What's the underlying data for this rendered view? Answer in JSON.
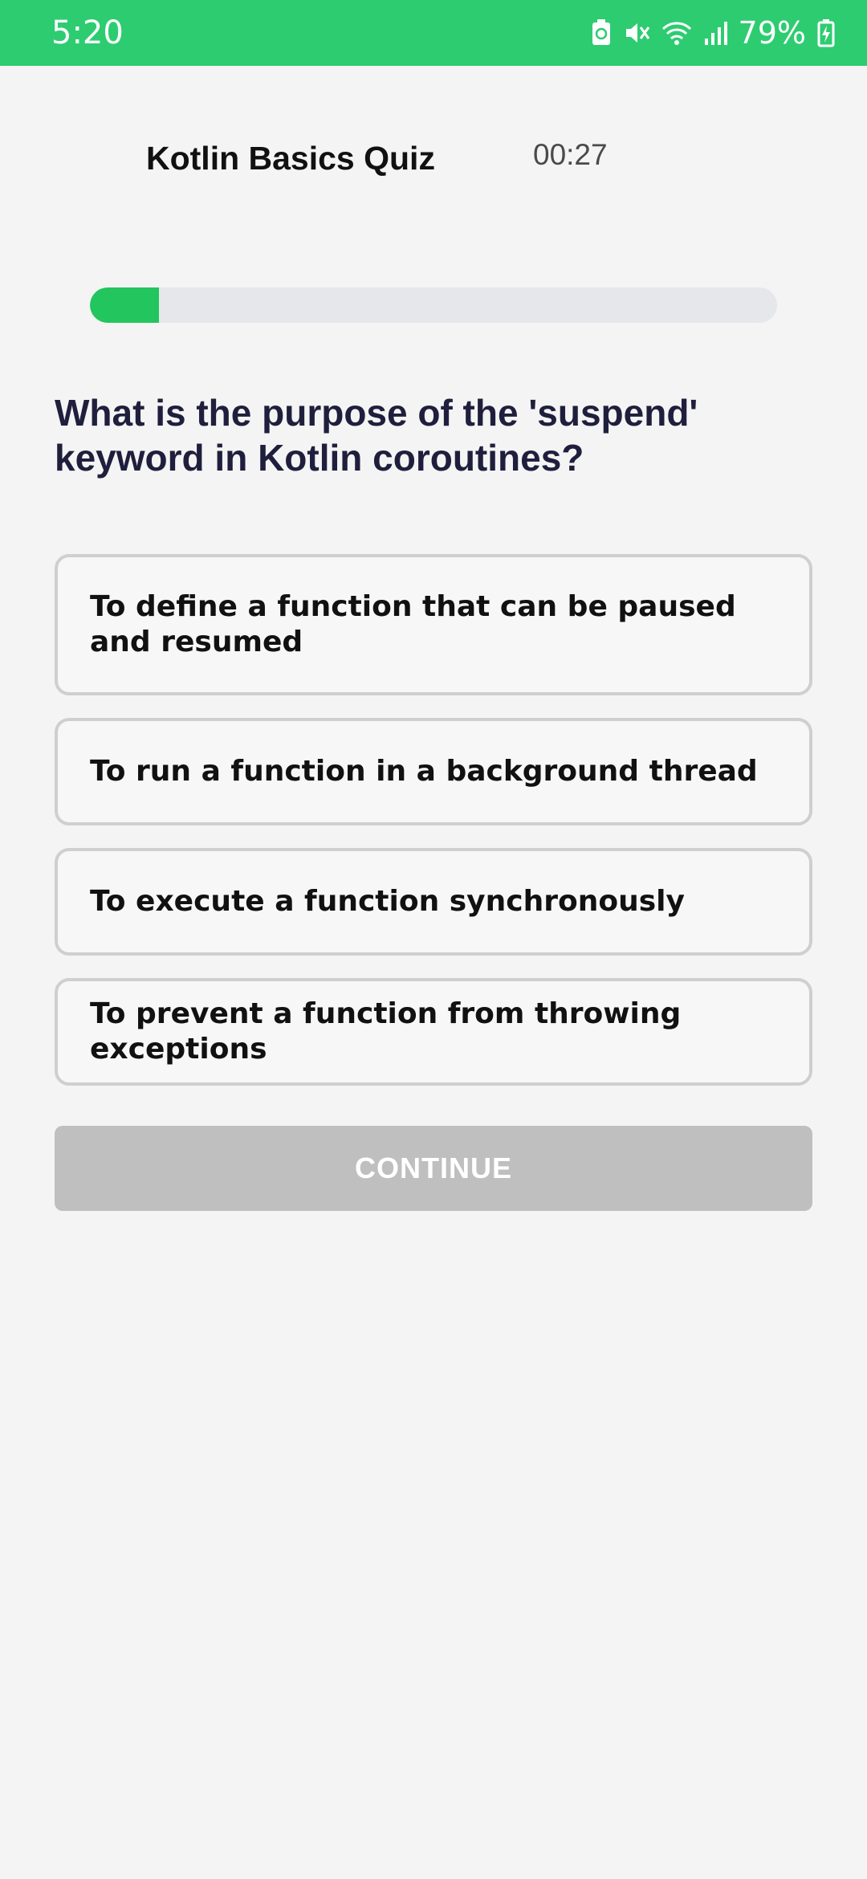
{
  "status_bar": {
    "time": "5:20",
    "battery_percent": "79%",
    "icons": [
      "battery-saver-icon",
      "mute-icon",
      "wifi-icon",
      "signal-icon",
      "battery-charging-icon"
    ]
  },
  "header": {
    "title": "Kotlin Basics Quiz",
    "timer": "00:27"
  },
  "progress": {
    "fraction": 0.1
  },
  "question": {
    "text": "What is the purpose of the 'suspend' keyword in Kotlin coroutines?"
  },
  "options": [
    {
      "label": "To define a function that can be paused and resumed"
    },
    {
      "label": "To run a function in a background thread"
    },
    {
      "label": "To execute a function synchronously"
    },
    {
      "label": "To prevent a function from throwing exceptions"
    }
  ],
  "continue_button": {
    "label": "CONTINUE",
    "enabled": false
  },
  "colors": {
    "status_bar": "#2ecc71",
    "progress_fill": "#22c55e",
    "progress_track": "#e6e7ea",
    "question_text": "#1f1f3d",
    "button_disabled": "#bfbfbf",
    "background": "#f4f4f4"
  }
}
